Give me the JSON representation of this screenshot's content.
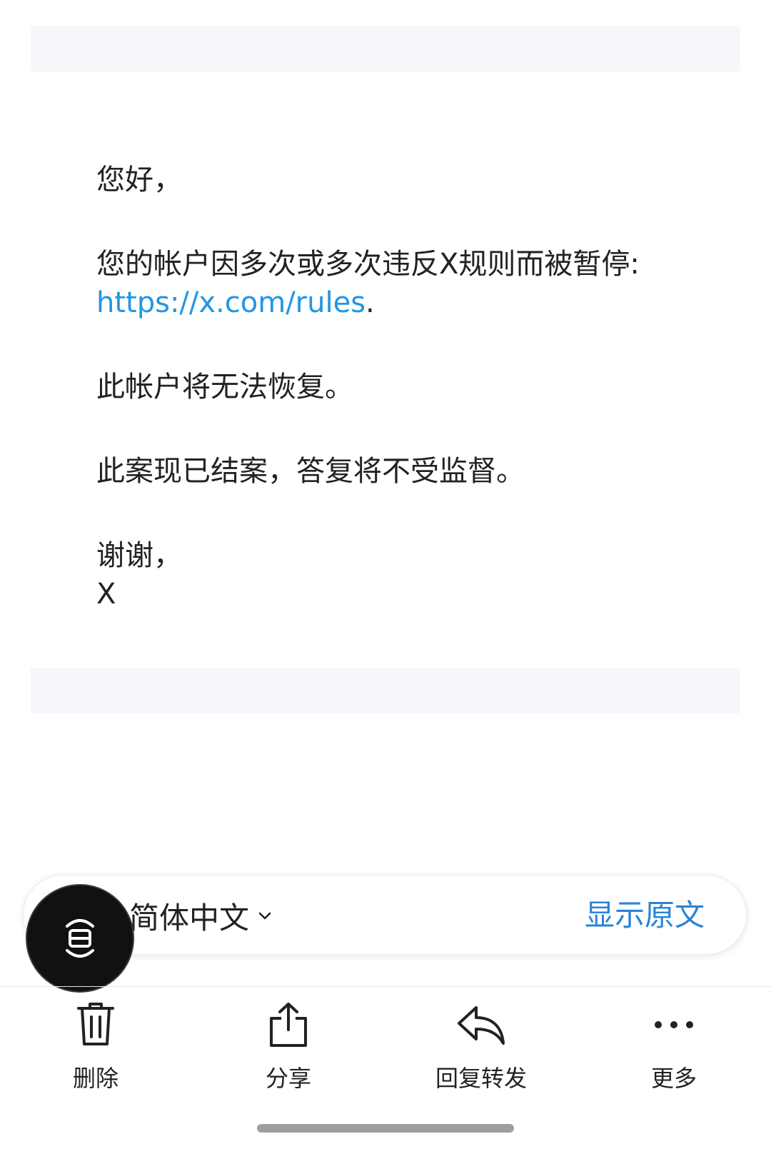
{
  "email": {
    "greeting": "您好，",
    "notice_text": "您的帐户因多次或多次违反X规则而被暂停:",
    "rules_link": "https://x.com/rules",
    "link_suffix": ".",
    "unrecoverable": "此帐户将无法恢复。",
    "case_closed": "此案现已结案，答复将不受监督。",
    "signoff": "谢谢，",
    "sender": "X"
  },
  "translation": {
    "language": "简体中文",
    "show_original": "显示原文"
  },
  "toolbar": {
    "items": [
      {
        "label": "删除",
        "icon": "trash-icon"
      },
      {
        "label": "分享",
        "icon": "share-icon"
      },
      {
        "label": "回复转发",
        "icon": "reply-icon"
      },
      {
        "label": "更多",
        "icon": "more-dots-icon"
      }
    ]
  },
  "colors": {
    "link": "#2196e3",
    "show_original": "#2a84d6",
    "fab": "#111111",
    "band": "#f5f7fa"
  }
}
